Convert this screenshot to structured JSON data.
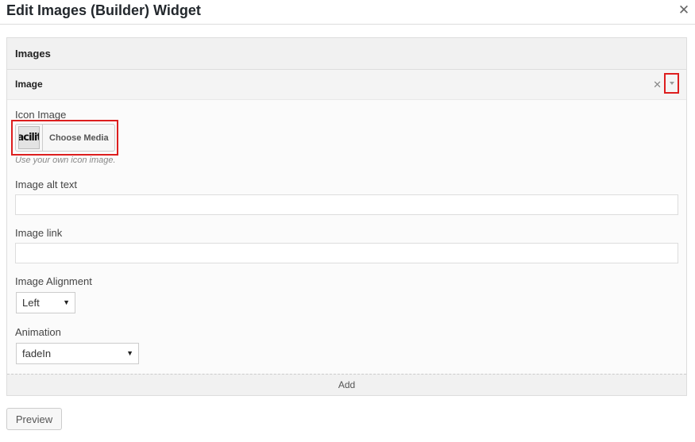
{
  "dialog": {
    "title": "Edit Images (Builder) Widget",
    "close_icon": "close-icon"
  },
  "panel": {
    "title": "Images"
  },
  "item": {
    "title": "Image"
  },
  "fields": {
    "icon_image": {
      "label": "Icon Image",
      "thumb_text": "acilit",
      "button_label": "Choose Media",
      "help": "Use your own icon image."
    },
    "alt_text": {
      "label": "Image alt text",
      "value": ""
    },
    "link": {
      "label": "Image link",
      "value": ""
    },
    "alignment": {
      "label": "Image Alignment",
      "selected": "Left"
    },
    "animation": {
      "label": "Animation",
      "selected": "fadeIn"
    }
  },
  "actions": {
    "add_label": "Add",
    "preview_label": "Preview"
  },
  "colors": {
    "highlight": "#dd1e1e",
    "border": "#dddddd"
  }
}
